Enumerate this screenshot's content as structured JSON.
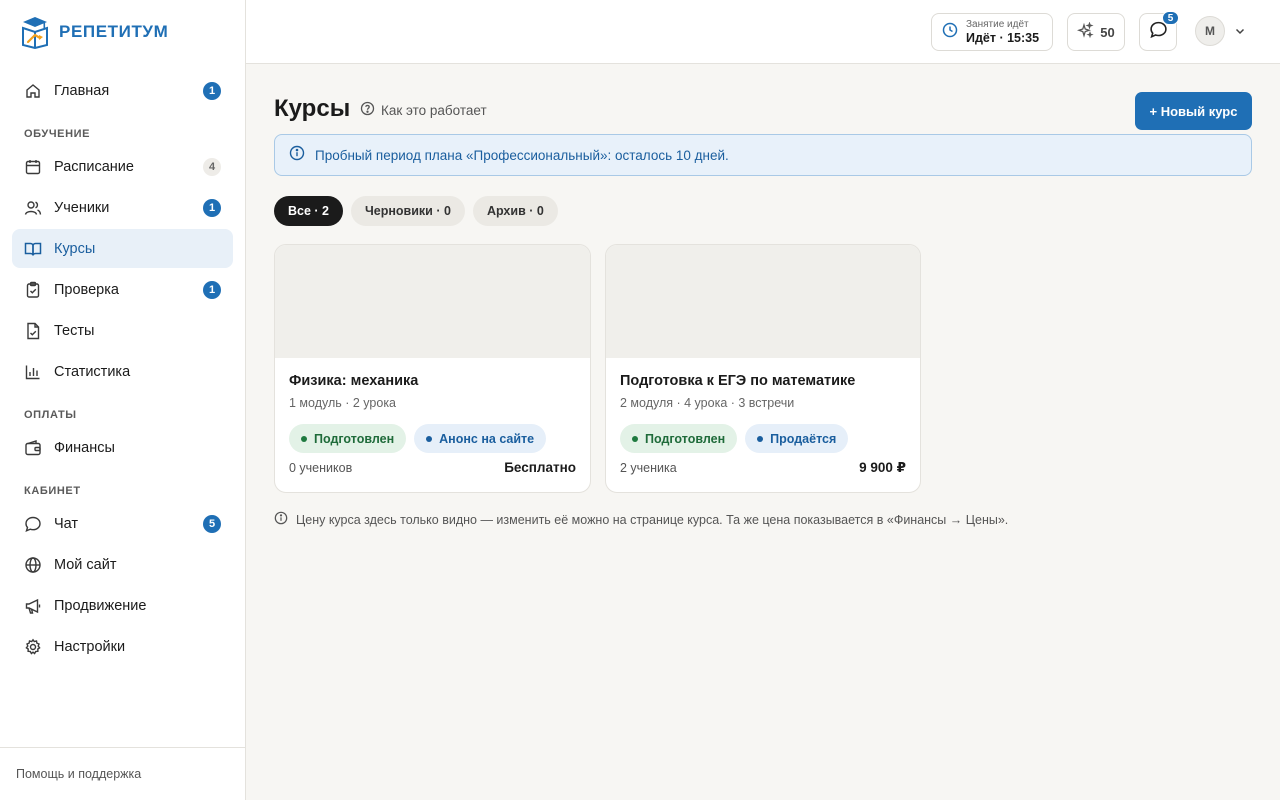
{
  "brand": {
    "name": "РЕПЕТИТУМ",
    "logo_icon": "graduation-book-logo",
    "color": "#1f6fb5"
  },
  "sidebar": {
    "items": [
      {
        "label": "Главная",
        "icon": "home-icon",
        "badge": "1"
      },
      {
        "section": "ОБУЧЕНИЕ"
      },
      {
        "label": "Расписание",
        "icon": "calendar-icon",
        "badge": "4"
      },
      {
        "label": "Ученики",
        "icon": "users-icon",
        "badge": "1"
      },
      {
        "label": "Курсы",
        "icon": "book-open-icon",
        "active": true
      },
      {
        "label": "Проверка",
        "icon": "clipboard-check-icon",
        "badge": "1"
      },
      {
        "label": "Тесты",
        "icon": "file-check-icon"
      },
      {
        "label": "Статистика",
        "icon": "bar-chart-icon"
      },
      {
        "section": "ОПЛАТЫ"
      },
      {
        "label": "Финансы",
        "icon": "wallet-icon"
      },
      {
        "section": "КАБИНЕТ"
      },
      {
        "label": "Чат",
        "icon": "chat-icon",
        "badge": "5"
      },
      {
        "label": "Мой сайт",
        "icon": "globe-icon"
      },
      {
        "label": "Продвижение",
        "icon": "megaphone-icon"
      },
      {
        "label": "Настройки",
        "icon": "gear-icon"
      }
    ],
    "footer": "Помощь и поддержка"
  },
  "topbar": {
    "lesson": {
      "small": "Занятие идёт",
      "big": "Идёт · 15:35",
      "icon": "clock-icon"
    },
    "coins": {
      "value": "50",
      "icon": "sparkle-icon"
    },
    "chat": {
      "badge": "5",
      "icon": "chat-icon"
    },
    "avatar": "М"
  },
  "page": {
    "title": "Курсы",
    "how_it_works": "Как это работает",
    "new_course": "+ Новый курс",
    "alert": "Пробный период плана «Профессиональный»: осталось 10 дней.",
    "filters": [
      {
        "label": "Все · 2",
        "active": true
      },
      {
        "label": "Черновики · 0"
      },
      {
        "label": "Архив · 0"
      }
    ],
    "courses": [
      {
        "title": "Физика: механика",
        "meta": "1 модуль · 2 урока",
        "tags": [
          {
            "label": "Подготовлен",
            "tone": "green"
          },
          {
            "label": "Анонс на сайте",
            "tone": "blue"
          }
        ],
        "students": "0 учеников",
        "price": "Бесплатно"
      },
      {
        "title": "Подготовка к ЕГЭ по математике",
        "meta": "2 модуля · 4 урока · 3 встречи",
        "tags": [
          {
            "label": "Подготовлен",
            "tone": "green"
          },
          {
            "label": "Продаётся",
            "tone": "blue"
          }
        ],
        "students": "2 ученика",
        "price": "9 900 ₽"
      }
    ],
    "note": "Цену курса здесь только видно — изменить её можно на странице курса. Та же цена показывается в «Финансы → Цены»."
  }
}
